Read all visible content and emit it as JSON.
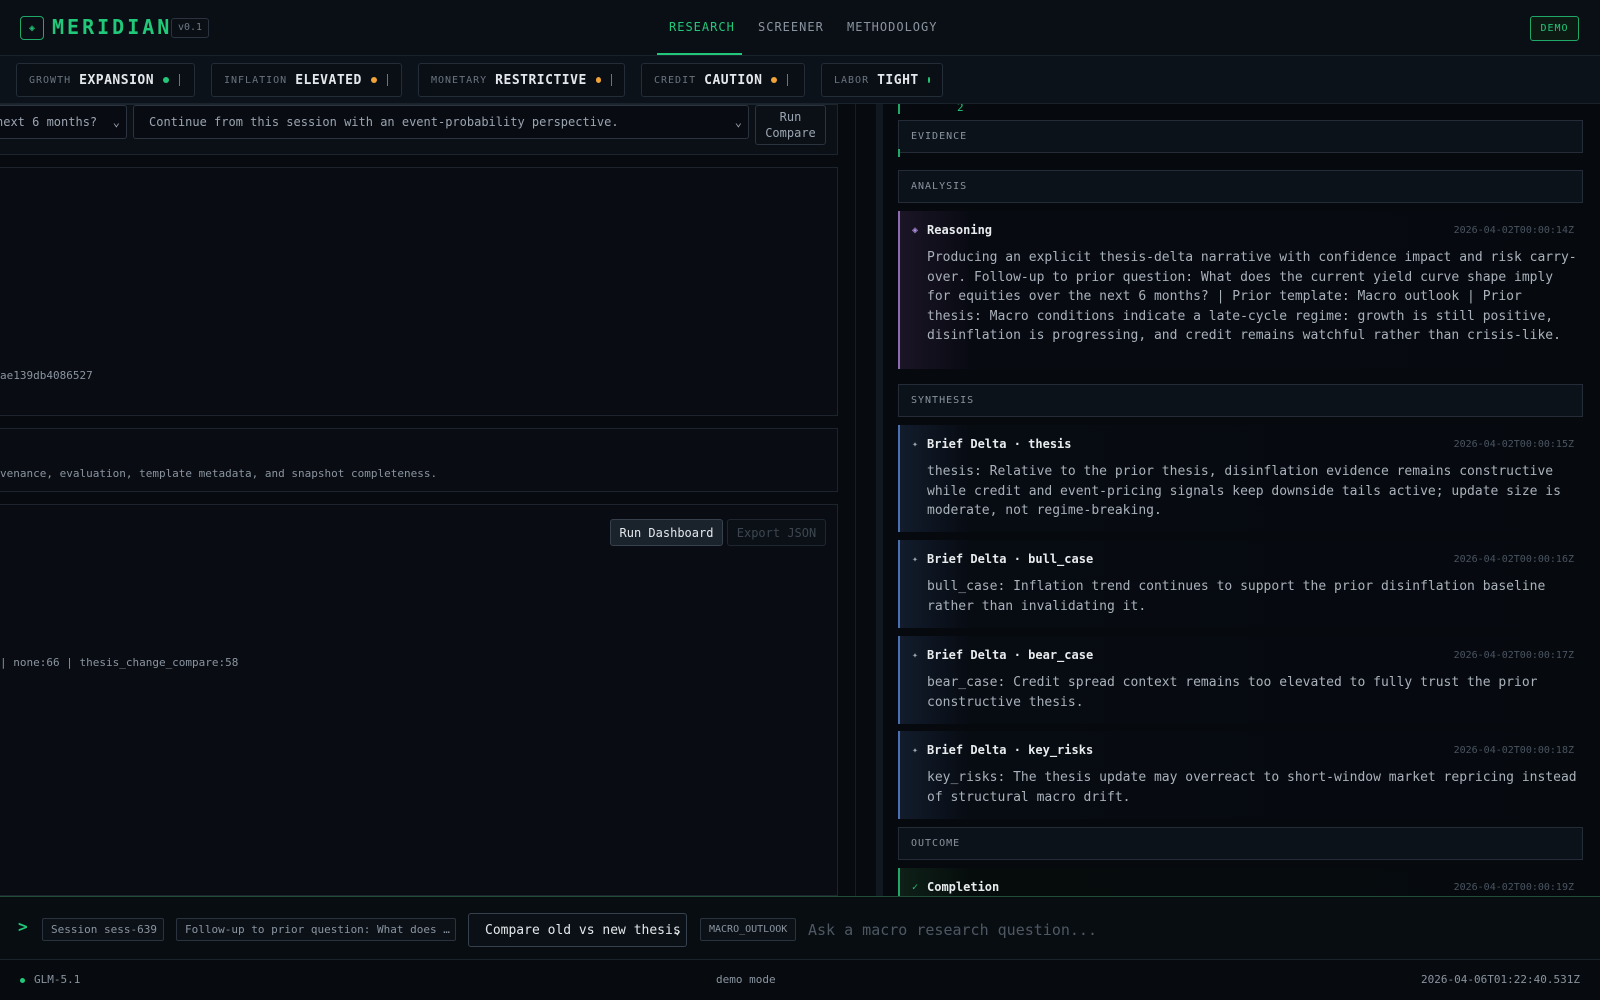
{
  "header": {
    "brand": "MERIDIAN",
    "version": "v0.1",
    "nav": [
      "RESEARCH",
      "SCREENER",
      "METHODOLOGY"
    ],
    "active_nav": "RESEARCH",
    "demo_label": "DEMO",
    "accent_color": "#22c879"
  },
  "regimes": [
    {
      "label": "GROWTH",
      "value": "EXPANSION",
      "status_color": "#22c879"
    },
    {
      "label": "INFLATION",
      "value": "ELEVATED",
      "status_color": "#f0a336"
    },
    {
      "label": "MONETARY",
      "value": "RESTRICTIVE",
      "status_color": "#f0a336"
    },
    {
      "label": "CREDIT",
      "value": "CAUTION",
      "status_color": "#f0a336"
    },
    {
      "label": "LABOR",
      "value": "TIGHT",
      "status_color": "#22c879"
    }
  ],
  "workspace": {
    "question_select": "next 6 months?",
    "perspective_select": "Continue from this session with an event-probability perspective.",
    "run_compare_label": "Run Compare",
    "hash_text": "ae139db4086527",
    "provenance_text": "venance, evaluation, template metadata, and snapshot completeness.",
    "counts_text": "| none:66 | thesis_change_compare:58",
    "run_dashboard_label": "Run Dashboard",
    "export_json_label": "Export JSON"
  },
  "stream": {
    "top_number": "2",
    "sections": {
      "evidence": "EVIDENCE",
      "analysis": "ANALYSIS",
      "synthesis": "SYNTHESIS",
      "outcome": "OUTCOME"
    },
    "events": {
      "reasoning": {
        "icon": "diamond-icon",
        "title": "Reasoning",
        "time": "2026-04-02T00:00:14Z",
        "body": "Producing an explicit thesis-delta narrative with confidence impact and risk carry-over. Follow-up to prior question: What does the current yield curve shape imply for equities over the next 6 months? | Prior template: Macro outlook | Prior thesis: Macro conditions indicate a late-cycle regime: growth is still positive, disinflation is progressing, and credit remains watchful rather than crisis-like."
      },
      "thesis": {
        "icon": "sparkle-icon",
        "title": "Brief Delta · thesis",
        "time": "2026-04-02T00:00:15Z",
        "body": "thesis: Relative to the prior thesis, disinflation evidence remains constructive while credit and event-pricing signals keep downside tails active; update size is moderate, not regime-breaking."
      },
      "bull_case": {
        "icon": "sparkle-icon",
        "title": "Brief Delta · bull_case",
        "time": "2026-04-02T00:00:16Z",
        "body": "bull_case: Inflation trend continues to support the prior disinflation baseline rather than invalidating it."
      },
      "bear_case": {
        "icon": "sparkle-icon",
        "title": "Brief Delta · bear_case",
        "time": "2026-04-02T00:00:17Z",
        "body": "bear_case: Credit spread context remains too elevated to fully trust the prior constructive thesis."
      },
      "key_risks": {
        "icon": "sparkle-icon",
        "title": "Brief Delta · key_risks",
        "time": "2026-04-02T00:00:18Z",
        "body": "key_risks: The thesis update may overreact to short-window market repricing instead of structural macro drift."
      },
      "completion": {
        "icon": "check-icon",
        "title": "Completion",
        "time": "2026-04-02T00:00:19Z"
      }
    }
  },
  "input_bar": {
    "session_chip": "Session sess-639",
    "followup_chip": "Follow-up to prior question: What does …",
    "mode_select": "Compare old vs new thesis",
    "template_tag": "MACRO_OUTLOOK",
    "placeholder": "Ask a macro research question..."
  },
  "status_bar": {
    "model": "GLM-5.1",
    "mode": "demo mode",
    "clock": "2026-04-06T01:22:40.531Z"
  }
}
